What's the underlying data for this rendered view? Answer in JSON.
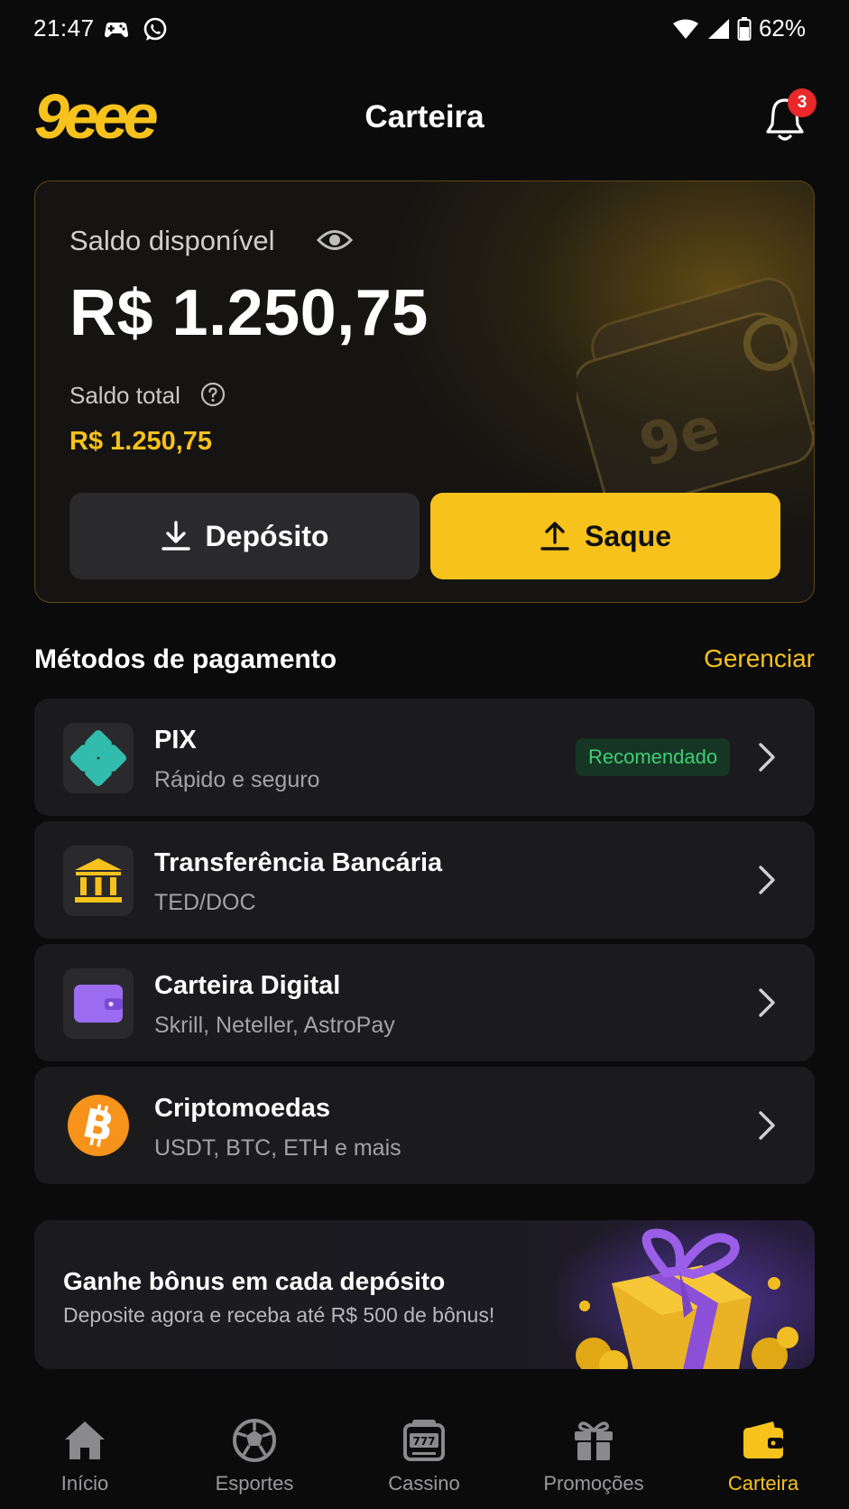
{
  "status_bar": {
    "time": "21:47",
    "battery": "62%"
  },
  "header": {
    "logo": "9eee",
    "title": "Carteira",
    "notification_count": "3"
  },
  "wallet": {
    "available_label": "Saldo disponível",
    "available_balance": "R$ 1.250,75",
    "total_label": "Saldo total",
    "total_balance": "R$ 1.250,75",
    "deposit_label": "Depósito",
    "withdraw_label": "Saque"
  },
  "payment_methods": {
    "title": "Métodos de pagamento",
    "manage_label": "Gerenciar",
    "items": [
      {
        "title": "PIX",
        "subtitle": "Rápido e seguro",
        "badge": "Recomendado",
        "icon": "pix-icon"
      },
      {
        "title": "Transferência Bancária",
        "subtitle": "TED/DOC",
        "icon": "bank-icon"
      },
      {
        "title": "Carteira Digital",
        "subtitle": "Skrill, Neteller, AstroPay",
        "icon": "wallet-icon"
      },
      {
        "title": "Criptomoedas",
        "subtitle": "USDT, BTC, ETH e mais",
        "icon": "bitcoin-icon"
      }
    ]
  },
  "promo": {
    "title": "Ganhe bônus em cada depósito",
    "subtitle": "Deposite agora e receba até R$ 500 de bônus!"
  },
  "bottom_nav": {
    "items": [
      {
        "label": "Início",
        "icon": "home-icon"
      },
      {
        "label": "Esportes",
        "icon": "soccer-ball-icon"
      },
      {
        "label": "Cassino",
        "icon": "slot-machine-icon"
      },
      {
        "label": "Promoções",
        "icon": "gift-icon"
      },
      {
        "label": "Carteira",
        "icon": "wallet-icon",
        "active": true
      }
    ]
  },
  "colors": {
    "accent": "#f7c21b",
    "background": "#0b0b0c",
    "card": "#1b1b1d",
    "success": "#3ecf75",
    "badge": "#e8282b"
  }
}
